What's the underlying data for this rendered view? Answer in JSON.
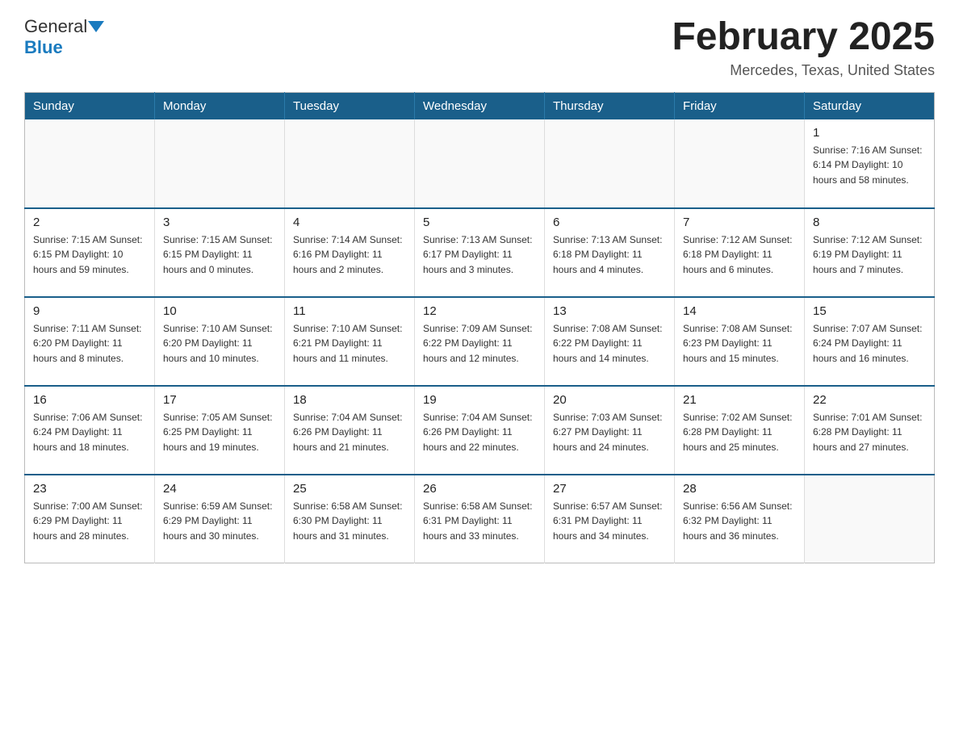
{
  "header": {
    "logo_general": "General",
    "logo_blue": "Blue",
    "month_title": "February 2025",
    "location": "Mercedes, Texas, United States"
  },
  "weekdays": [
    "Sunday",
    "Monday",
    "Tuesday",
    "Wednesday",
    "Thursday",
    "Friday",
    "Saturday"
  ],
  "weeks": [
    [
      {
        "day": "",
        "info": ""
      },
      {
        "day": "",
        "info": ""
      },
      {
        "day": "",
        "info": ""
      },
      {
        "day": "",
        "info": ""
      },
      {
        "day": "",
        "info": ""
      },
      {
        "day": "",
        "info": ""
      },
      {
        "day": "1",
        "info": "Sunrise: 7:16 AM\nSunset: 6:14 PM\nDaylight: 10 hours\nand 58 minutes."
      }
    ],
    [
      {
        "day": "2",
        "info": "Sunrise: 7:15 AM\nSunset: 6:15 PM\nDaylight: 10 hours\nand 59 minutes."
      },
      {
        "day": "3",
        "info": "Sunrise: 7:15 AM\nSunset: 6:15 PM\nDaylight: 11 hours\nand 0 minutes."
      },
      {
        "day": "4",
        "info": "Sunrise: 7:14 AM\nSunset: 6:16 PM\nDaylight: 11 hours\nand 2 minutes."
      },
      {
        "day": "5",
        "info": "Sunrise: 7:13 AM\nSunset: 6:17 PM\nDaylight: 11 hours\nand 3 minutes."
      },
      {
        "day": "6",
        "info": "Sunrise: 7:13 AM\nSunset: 6:18 PM\nDaylight: 11 hours\nand 4 minutes."
      },
      {
        "day": "7",
        "info": "Sunrise: 7:12 AM\nSunset: 6:18 PM\nDaylight: 11 hours\nand 6 minutes."
      },
      {
        "day": "8",
        "info": "Sunrise: 7:12 AM\nSunset: 6:19 PM\nDaylight: 11 hours\nand 7 minutes."
      }
    ],
    [
      {
        "day": "9",
        "info": "Sunrise: 7:11 AM\nSunset: 6:20 PM\nDaylight: 11 hours\nand 8 minutes."
      },
      {
        "day": "10",
        "info": "Sunrise: 7:10 AM\nSunset: 6:20 PM\nDaylight: 11 hours\nand 10 minutes."
      },
      {
        "day": "11",
        "info": "Sunrise: 7:10 AM\nSunset: 6:21 PM\nDaylight: 11 hours\nand 11 minutes."
      },
      {
        "day": "12",
        "info": "Sunrise: 7:09 AM\nSunset: 6:22 PM\nDaylight: 11 hours\nand 12 minutes."
      },
      {
        "day": "13",
        "info": "Sunrise: 7:08 AM\nSunset: 6:22 PM\nDaylight: 11 hours\nand 14 minutes."
      },
      {
        "day": "14",
        "info": "Sunrise: 7:08 AM\nSunset: 6:23 PM\nDaylight: 11 hours\nand 15 minutes."
      },
      {
        "day": "15",
        "info": "Sunrise: 7:07 AM\nSunset: 6:24 PM\nDaylight: 11 hours\nand 16 minutes."
      }
    ],
    [
      {
        "day": "16",
        "info": "Sunrise: 7:06 AM\nSunset: 6:24 PM\nDaylight: 11 hours\nand 18 minutes."
      },
      {
        "day": "17",
        "info": "Sunrise: 7:05 AM\nSunset: 6:25 PM\nDaylight: 11 hours\nand 19 minutes."
      },
      {
        "day": "18",
        "info": "Sunrise: 7:04 AM\nSunset: 6:26 PM\nDaylight: 11 hours\nand 21 minutes."
      },
      {
        "day": "19",
        "info": "Sunrise: 7:04 AM\nSunset: 6:26 PM\nDaylight: 11 hours\nand 22 minutes."
      },
      {
        "day": "20",
        "info": "Sunrise: 7:03 AM\nSunset: 6:27 PM\nDaylight: 11 hours\nand 24 minutes."
      },
      {
        "day": "21",
        "info": "Sunrise: 7:02 AM\nSunset: 6:28 PM\nDaylight: 11 hours\nand 25 minutes."
      },
      {
        "day": "22",
        "info": "Sunrise: 7:01 AM\nSunset: 6:28 PM\nDaylight: 11 hours\nand 27 minutes."
      }
    ],
    [
      {
        "day": "23",
        "info": "Sunrise: 7:00 AM\nSunset: 6:29 PM\nDaylight: 11 hours\nand 28 minutes."
      },
      {
        "day": "24",
        "info": "Sunrise: 6:59 AM\nSunset: 6:29 PM\nDaylight: 11 hours\nand 30 minutes."
      },
      {
        "day": "25",
        "info": "Sunrise: 6:58 AM\nSunset: 6:30 PM\nDaylight: 11 hours\nand 31 minutes."
      },
      {
        "day": "26",
        "info": "Sunrise: 6:58 AM\nSunset: 6:31 PM\nDaylight: 11 hours\nand 33 minutes."
      },
      {
        "day": "27",
        "info": "Sunrise: 6:57 AM\nSunset: 6:31 PM\nDaylight: 11 hours\nand 34 minutes."
      },
      {
        "day": "28",
        "info": "Sunrise: 6:56 AM\nSunset: 6:32 PM\nDaylight: 11 hours\nand 36 minutes."
      },
      {
        "day": "",
        "info": ""
      }
    ]
  ]
}
